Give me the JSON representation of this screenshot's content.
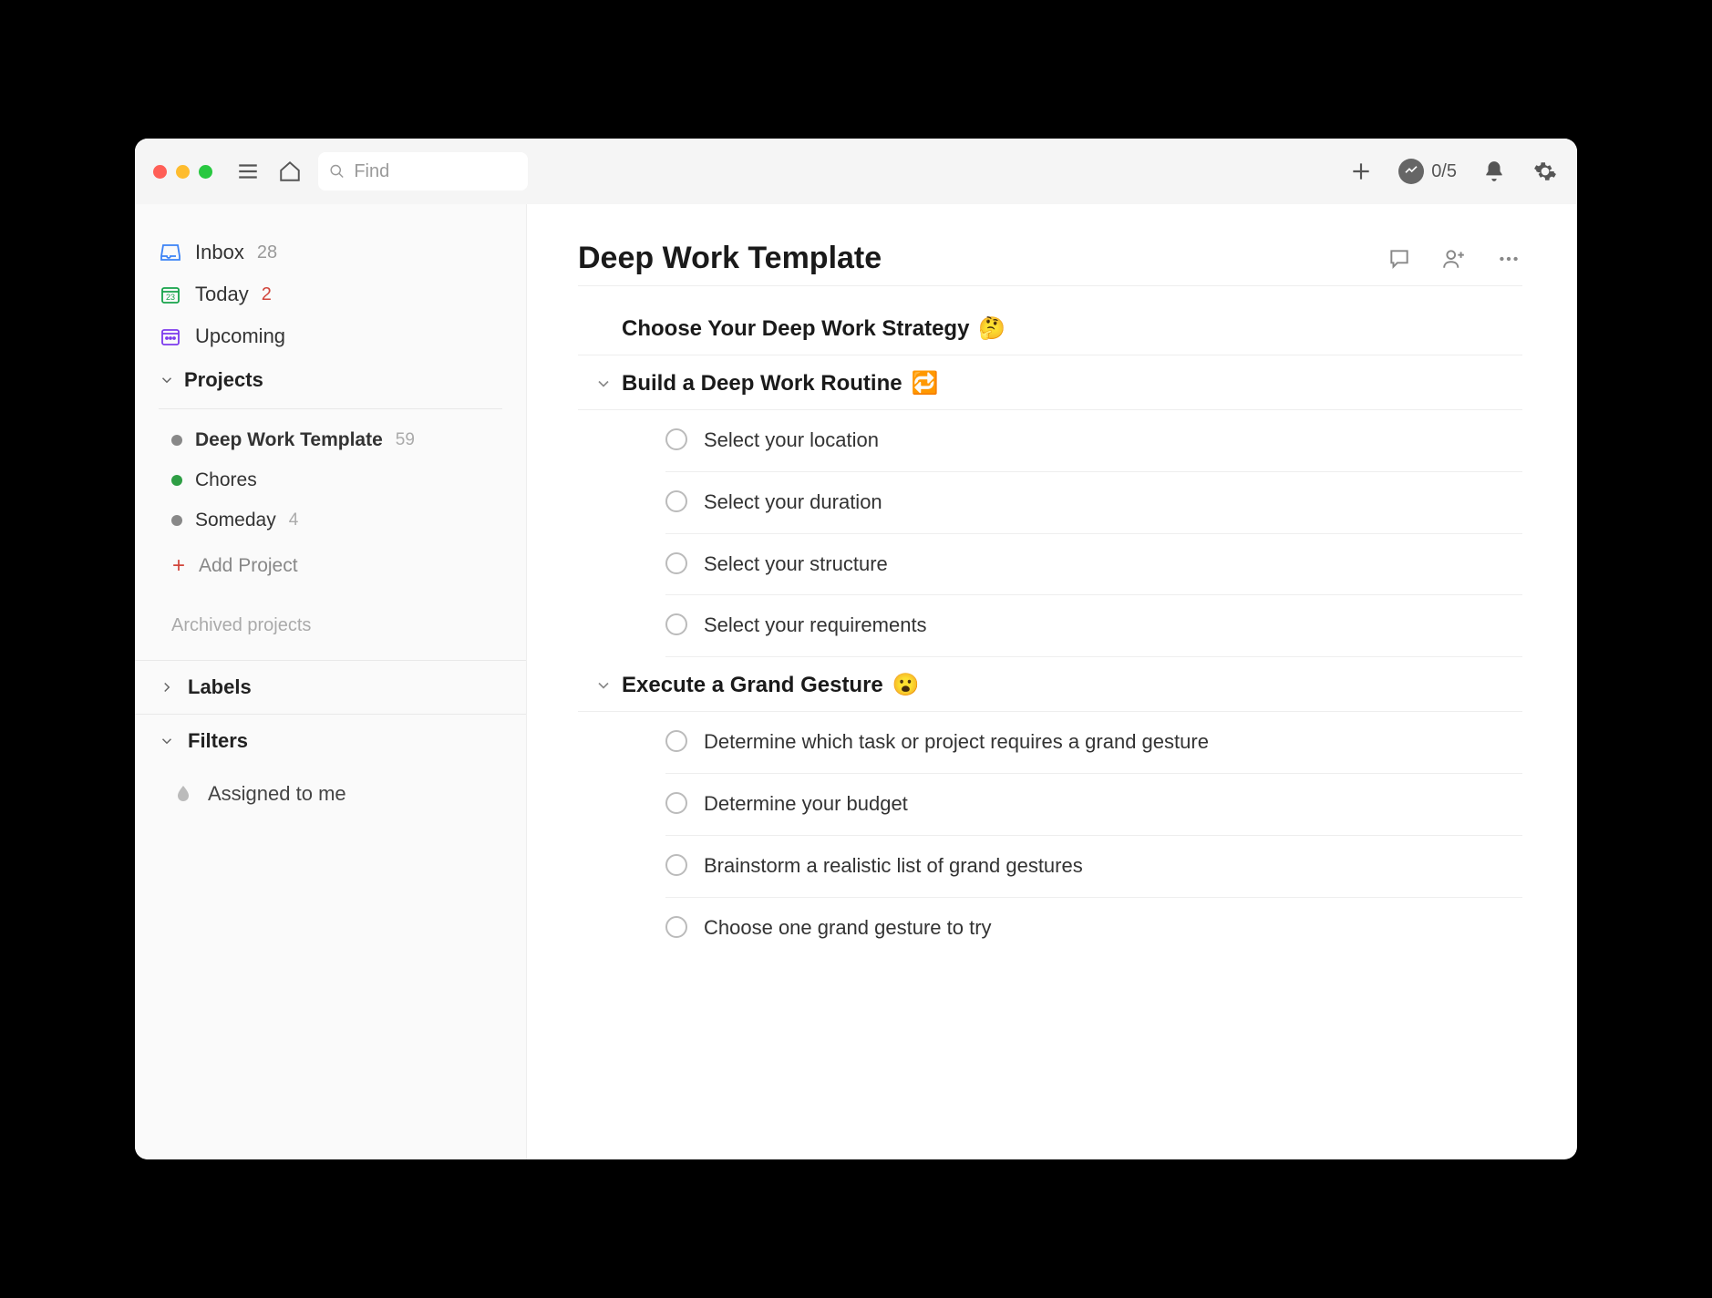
{
  "search": {
    "placeholder": "Find"
  },
  "productivity": {
    "text": "0/5"
  },
  "sidebar": {
    "inbox": {
      "label": "Inbox",
      "count": "28"
    },
    "today": {
      "label": "Today",
      "count": "2"
    },
    "upcoming": {
      "label": "Upcoming"
    },
    "projects_header": "Projects",
    "projects": [
      {
        "name": "Deep Work Template",
        "count": "59",
        "color": "#888888"
      },
      {
        "name": "Chores",
        "count": "",
        "color": "#2e9e44"
      },
      {
        "name": "Someday",
        "count": "4",
        "color": "#888888"
      }
    ],
    "add_project": "Add Project",
    "archived": "Archived projects",
    "labels": "Labels",
    "filters": "Filters",
    "assigned": "Assigned to me"
  },
  "main": {
    "title": "Deep Work Template",
    "sections": [
      {
        "title": "Choose Your Deep Work Strategy",
        "emoji": "🤔",
        "collapsed": true,
        "tasks": []
      },
      {
        "title": "Build a Deep Work Routine",
        "emoji": "🔁",
        "collapsed": false,
        "tasks": [
          "Select your location",
          "Select your duration",
          "Select your structure",
          "Select your requirements"
        ]
      },
      {
        "title": "Execute a Grand Gesture",
        "emoji": "😮",
        "collapsed": false,
        "tasks": [
          "Determine which task or project requires a grand gesture",
          "Determine your budget",
          "Brainstorm a realistic list of grand gestures",
          "Choose one grand gesture to try"
        ]
      }
    ]
  }
}
